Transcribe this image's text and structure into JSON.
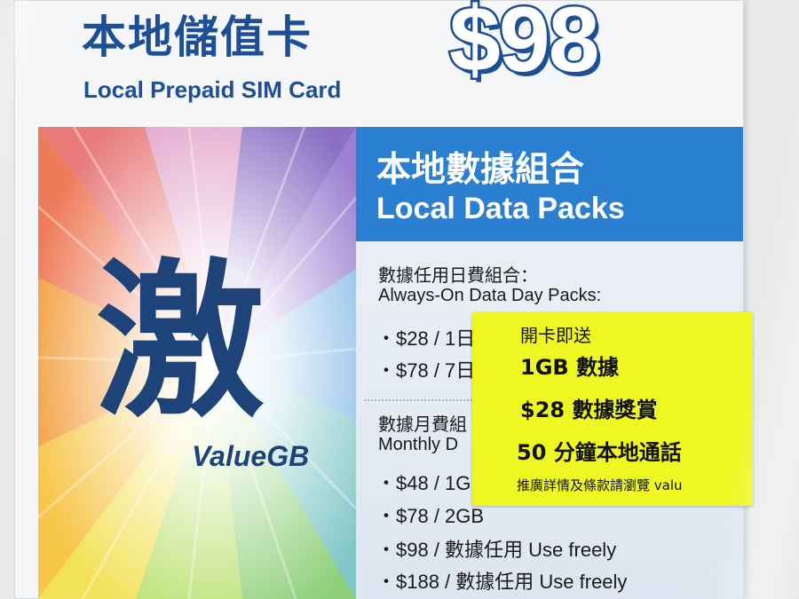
{
  "card": {
    "title_zh": "本地儲值卡",
    "title_en": "Local Prepaid SIM Card",
    "price": "$98",
    "brand_char": "激",
    "brand_name": "ValueGB"
  },
  "data_panel": {
    "heading_zh": "本地數據組合",
    "heading_en": "Local Data Packs",
    "day_packs": {
      "heading_zh": "數據任用日費組合：",
      "heading_en": "Always-On Data Day Packs:",
      "items": [
        "・$28 / 1日",
        "・$78 / 7日"
      ]
    },
    "monthly_packs": {
      "heading_zh": "數據月費組",
      "heading_en": "Monthly D",
      "items": [
        "・$48 / 1G",
        "・$78 / 2GB",
        "・$98 / 數據任用 Use freely",
        "・$188 / 數據任用 Use freely"
      ]
    }
  },
  "sticker": {
    "header": "開卡即送",
    "line1": "1GB 數據",
    "line2": "$28 數據獎賞",
    "line3": "50 分鐘本地通話",
    "footer": "推廣詳情及條款請瀏覽 valu"
  },
  "colors": {
    "brand_blue": "#1d4f96",
    "banner_blue": "#2b7fd0",
    "sticker_yellow": "#eef722"
  }
}
